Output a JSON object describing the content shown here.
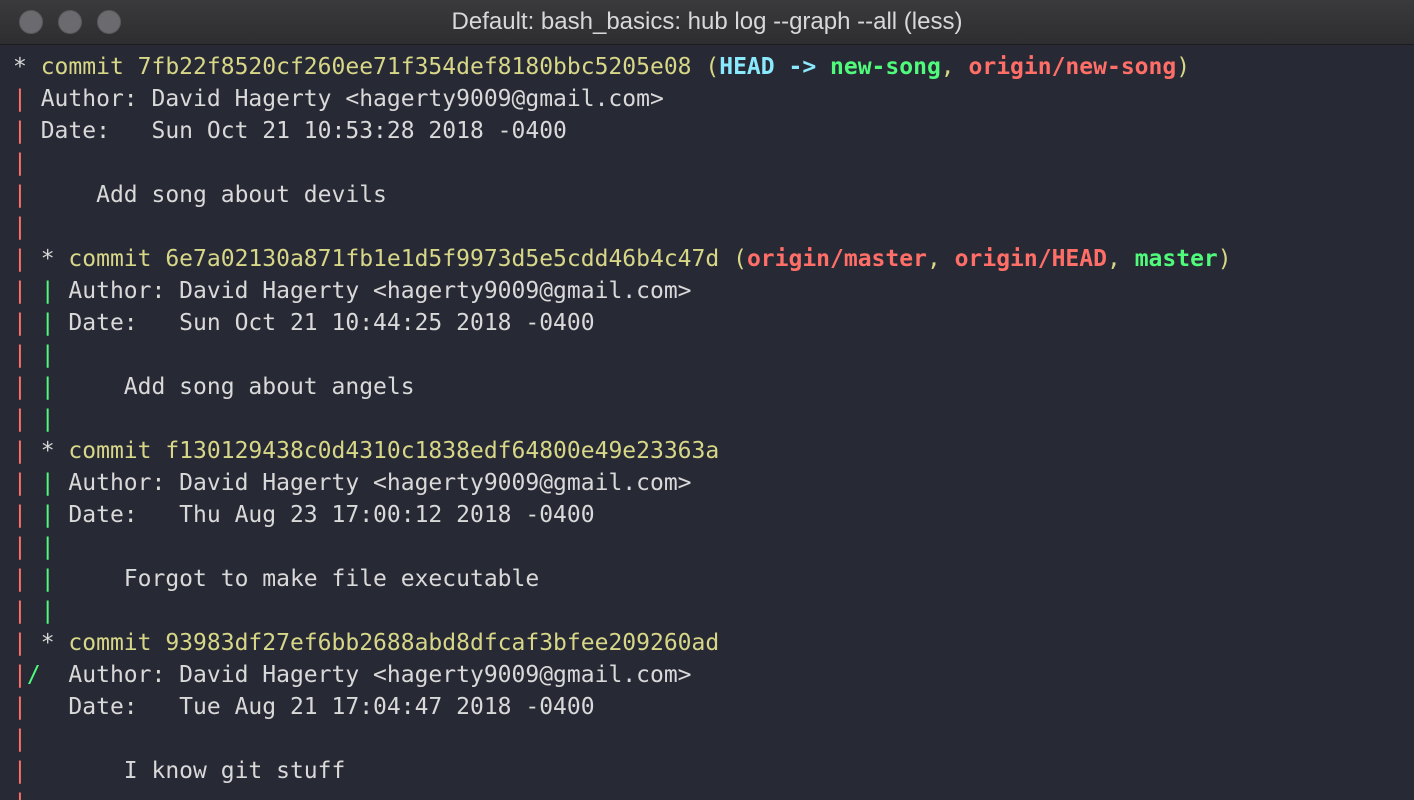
{
  "window": {
    "title": "Default: bash_basics: hub log --graph --all (less)"
  },
  "colors": {
    "background": "#272935",
    "text": "#d9d9d9",
    "commit": "#d7d787",
    "head": "#8be9fd",
    "local_branch": "#50fa7b",
    "remote_branch": "#ff6e67",
    "graph_red": "#ff6e67",
    "graph_green": "#50fa7b"
  },
  "icons": {
    "close": "traffic-light-close",
    "minimize": "traffic-light-minimize",
    "zoom": "traffic-light-zoom"
  },
  "lines": [
    [
      {
        "t": "* ",
        "c": "text"
      },
      {
        "t": "commit 7fb22f8520cf260ee71f354def8180bbc5205e08",
        "c": "commit"
      },
      {
        "t": " (",
        "c": "commit"
      },
      {
        "t": "HEAD -> ",
        "c": "head",
        "b": true
      },
      {
        "t": "new-song",
        "c": "local_branch",
        "b": true
      },
      {
        "t": ", ",
        "c": "commit"
      },
      {
        "t": "origin/new-song",
        "c": "remote_branch",
        "b": true
      },
      {
        "t": ")",
        "c": "commit"
      }
    ],
    [
      {
        "t": "| ",
        "c": "graph_red"
      },
      {
        "t": "Author: David Hagerty <hagerty9009@gmail.com>",
        "c": "text"
      }
    ],
    [
      {
        "t": "| ",
        "c": "graph_red"
      },
      {
        "t": "Date:   Sun Oct 21 10:53:28 2018 -0400",
        "c": "text"
      }
    ],
    [
      {
        "t": "|",
        "c": "graph_red"
      }
    ],
    [
      {
        "t": "| ",
        "c": "graph_red"
      },
      {
        "t": "    Add song about devils",
        "c": "text"
      }
    ],
    [
      {
        "t": "|",
        "c": "graph_red"
      }
    ],
    [
      {
        "t": "| ",
        "c": "graph_red"
      },
      {
        "t": "* ",
        "c": "text"
      },
      {
        "t": "commit 6e7a02130a871fb1e1d5f9973d5e5cdd46b4c47d",
        "c": "commit"
      },
      {
        "t": " (",
        "c": "commit"
      },
      {
        "t": "origin/master",
        "c": "remote_branch",
        "b": true
      },
      {
        "t": ", ",
        "c": "commit"
      },
      {
        "t": "origin/HEAD",
        "c": "remote_branch",
        "b": true
      },
      {
        "t": ", ",
        "c": "commit"
      },
      {
        "t": "master",
        "c": "local_branch",
        "b": true
      },
      {
        "t": ")",
        "c": "commit"
      }
    ],
    [
      {
        "t": "| ",
        "c": "graph_red"
      },
      {
        "t": "| ",
        "c": "graph_green"
      },
      {
        "t": "Author: David Hagerty <hagerty9009@gmail.com>",
        "c": "text"
      }
    ],
    [
      {
        "t": "| ",
        "c": "graph_red"
      },
      {
        "t": "| ",
        "c": "graph_green"
      },
      {
        "t": "Date:   Sun Oct 21 10:44:25 2018 -0400",
        "c": "text"
      }
    ],
    [
      {
        "t": "| ",
        "c": "graph_red"
      },
      {
        "t": "|",
        "c": "graph_green"
      }
    ],
    [
      {
        "t": "| ",
        "c": "graph_red"
      },
      {
        "t": "| ",
        "c": "graph_green"
      },
      {
        "t": "    Add song about angels",
        "c": "text"
      }
    ],
    [
      {
        "t": "| ",
        "c": "graph_red"
      },
      {
        "t": "|",
        "c": "graph_green"
      }
    ],
    [
      {
        "t": "| ",
        "c": "graph_red"
      },
      {
        "t": "* ",
        "c": "text"
      },
      {
        "t": "commit f130129438c0d4310c1838edf64800e49e23363a",
        "c": "commit"
      }
    ],
    [
      {
        "t": "| ",
        "c": "graph_red"
      },
      {
        "t": "| ",
        "c": "graph_green"
      },
      {
        "t": "Author: David Hagerty <hagerty9009@gmail.com>",
        "c": "text"
      }
    ],
    [
      {
        "t": "| ",
        "c": "graph_red"
      },
      {
        "t": "| ",
        "c": "graph_green"
      },
      {
        "t": "Date:   Thu Aug 23 17:00:12 2018 -0400",
        "c": "text"
      }
    ],
    [
      {
        "t": "| ",
        "c": "graph_red"
      },
      {
        "t": "|",
        "c": "graph_green"
      }
    ],
    [
      {
        "t": "| ",
        "c": "graph_red"
      },
      {
        "t": "| ",
        "c": "graph_green"
      },
      {
        "t": "    Forgot to make file executable",
        "c": "text"
      }
    ],
    [
      {
        "t": "| ",
        "c": "graph_red"
      },
      {
        "t": "|",
        "c": "graph_green"
      }
    ],
    [
      {
        "t": "| ",
        "c": "graph_red"
      },
      {
        "t": "* ",
        "c": "text"
      },
      {
        "t": "commit 93983df27ef6bb2688abd8dfcaf3bfee209260ad",
        "c": "commit"
      }
    ],
    [
      {
        "t": "|",
        "c": "graph_red"
      },
      {
        "t": "/ ",
        "c": "graph_green"
      },
      {
        "t": " Author: David Hagerty <hagerty9009@gmail.com>",
        "c": "text"
      }
    ],
    [
      {
        "t": "| ",
        "c": "graph_red"
      },
      {
        "t": "  Date:   Tue Aug 21 17:04:47 2018 -0400",
        "c": "text"
      }
    ],
    [
      {
        "t": "|",
        "c": "graph_red"
      }
    ],
    [
      {
        "t": "| ",
        "c": "graph_red"
      },
      {
        "t": "      I know git stuff",
        "c": "text"
      }
    ],
    [
      {
        "t": "|",
        "c": "graph_red"
      }
    ]
  ]
}
